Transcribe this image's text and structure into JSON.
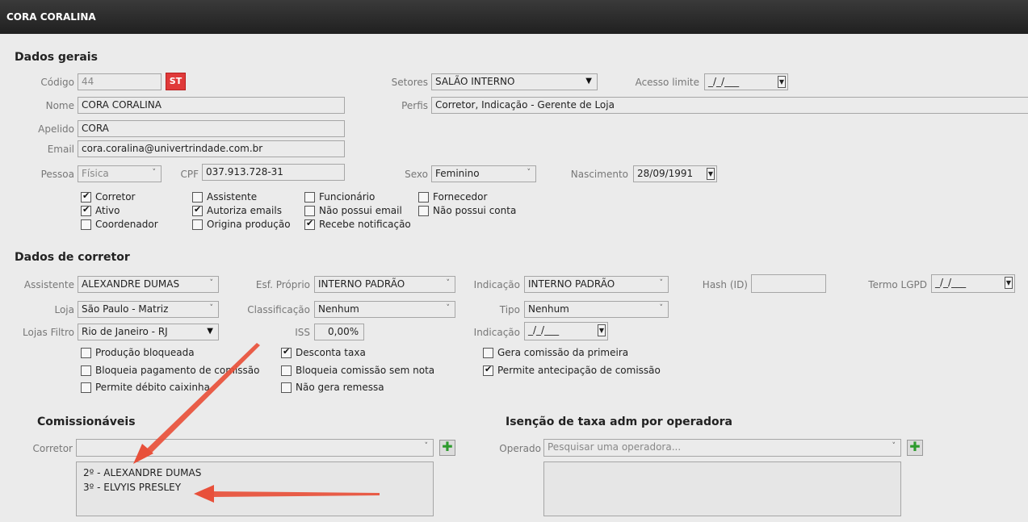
{
  "window": {
    "title": "CORA CORALINA"
  },
  "gerais": {
    "section_title": "Dados gerais",
    "codigo": {
      "label": "Código",
      "value": "44"
    },
    "st_button": "ST",
    "setores": {
      "label": "Setores",
      "value": "SALÃO INTERNO"
    },
    "acesso_limite": {
      "label": "Acesso limite",
      "value": "_/_/___"
    },
    "nome": {
      "label": "Nome",
      "value": "CORA CORALINA"
    },
    "perfis": {
      "label": "Perfis",
      "value": "Corretor, Indicação - Gerente de Loja"
    },
    "apelido": {
      "label": "Apelido",
      "value": "CORA"
    },
    "email": {
      "label": "Email",
      "value": "cora.coralina@univertrindade.com.br"
    },
    "pessoa": {
      "label": "Pessoa",
      "value": "Física"
    },
    "cpf": {
      "label": "CPF",
      "value": "037.913.728-31"
    },
    "sexo": {
      "label": "Sexo",
      "value": "Feminino"
    },
    "nascimento": {
      "label": "Nascimento",
      "value": "28/09/1991"
    },
    "checkboxes": [
      {
        "label": "Corretor",
        "checked": true
      },
      {
        "label": "Ativo",
        "checked": true
      },
      {
        "label": "Coordenador",
        "checked": false
      },
      {
        "label": "Assistente",
        "checked": false
      },
      {
        "label": "Autoriza emails",
        "checked": true
      },
      {
        "label": "Origina produção",
        "checked": false
      },
      {
        "label": "Funcionário",
        "checked": false
      },
      {
        "label": "Não possui email",
        "checked": false
      },
      {
        "label": "Recebe notificação",
        "checked": true
      },
      {
        "label": "Fornecedor",
        "checked": false
      },
      {
        "label": "Não possui conta",
        "checked": false
      }
    ]
  },
  "corretor": {
    "section_title": "Dados de corretor",
    "assistente": {
      "label": "Assistente",
      "value": "ALEXANDRE DUMAS"
    },
    "esf_proprio": {
      "label": "Esf. Próprio",
      "value": "INTERNO PADRÃO"
    },
    "indicacao": {
      "label": "Indicação",
      "value": "INTERNO PADRÃO"
    },
    "hash": {
      "label": "Hash (ID)",
      "value": ""
    },
    "termo_lgpd": {
      "label": "Termo LGPD",
      "value": "_/_/___"
    },
    "loja": {
      "label": "Loja",
      "value": "São Paulo - Matriz"
    },
    "classificacao": {
      "label": "Classificação",
      "value": "Nenhum"
    },
    "tipo": {
      "label": "Tipo",
      "value": "Nenhum"
    },
    "lojas_filtro": {
      "label": "Lojas Filtro",
      "value": "Rio de Janeiro - RJ"
    },
    "iss": {
      "label": "ISS",
      "value": "0,00%"
    },
    "indicacao_data": {
      "label": "Indicação",
      "value": "_/_/___"
    },
    "checkboxes": [
      {
        "label": "Produção bloqueada",
        "checked": false
      },
      {
        "label": "Bloqueia pagamento de comissão",
        "checked": false
      },
      {
        "label": "Permite débito caixinha",
        "checked": false
      },
      {
        "label": "Desconta taxa",
        "checked": true
      },
      {
        "label": "Bloqueia comissão sem nota",
        "checked": false
      },
      {
        "label": "Não gera remessa",
        "checked": false
      },
      {
        "label": "Gera comissão da primeira",
        "checked": false
      },
      {
        "label": "Permite antecipação de comissão",
        "checked": true
      }
    ]
  },
  "comissionaveis": {
    "section_title": "Comissionáveis",
    "corretor_label": "Corretor",
    "corretor_value": "",
    "items": [
      "2º - ALEXANDRE DUMAS",
      "3º - ELVYIS PRESLEY"
    ]
  },
  "isencao": {
    "section_title": "Isenção de taxa adm por operadora",
    "operadora_label": "Operado",
    "operadora_placeholder": "Pesquisar uma operadora..."
  },
  "colors": {
    "accent_red": "#e03a3a",
    "arrow": "#e8503a",
    "add_green": "#2e9b2e",
    "titlebar": "#2a2a2a"
  }
}
